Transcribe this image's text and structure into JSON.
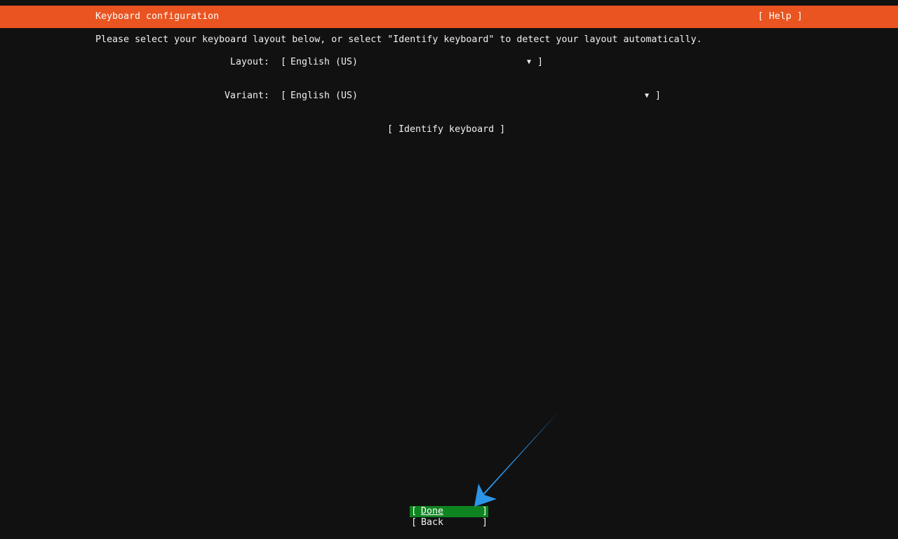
{
  "header": {
    "title": "Keyboard configuration",
    "help_label": "[ Help ]",
    "bg_color": "#e95420"
  },
  "instructions": "Please select your keyboard layout below, or select \"Identify keyboard\" to detect your layout automatically.",
  "layout": {
    "label": "Layout:",
    "value": "English (US)"
  },
  "variant": {
    "label": "Variant:",
    "value": "English (US)"
  },
  "identify_label": "[ Identify keyboard ]",
  "buttons": {
    "done_label": "Done",
    "back_label": "Back",
    "done_color": "#0e8420"
  },
  "icons": {
    "dropdown": "triangle-down-icon",
    "annotation": "annotation-arrow-icon"
  },
  "annotation_color": "#2b95e9"
}
